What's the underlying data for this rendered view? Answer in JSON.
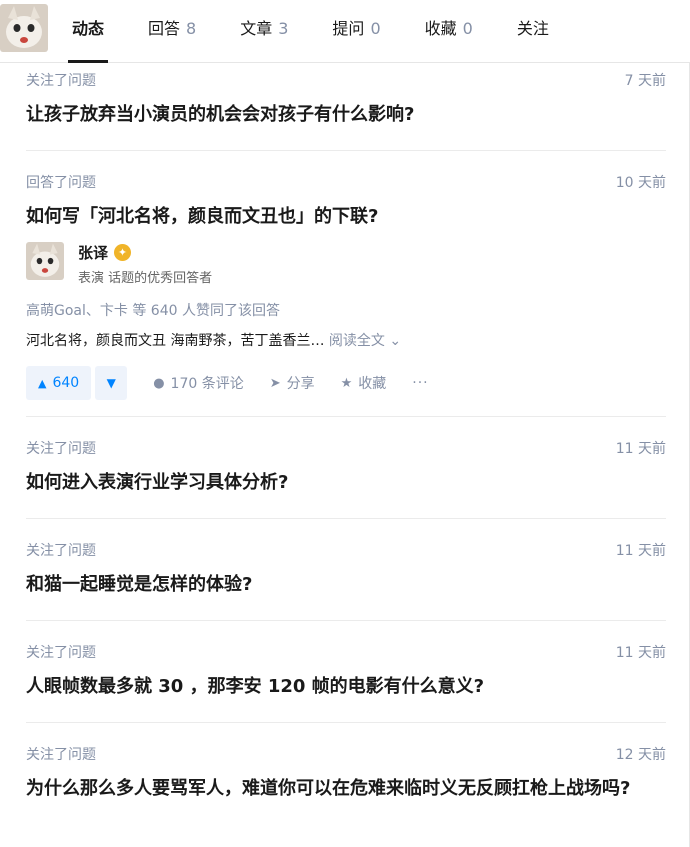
{
  "tabs": [
    {
      "label": "动态",
      "count": ""
    },
    {
      "label": "回答",
      "count": "8"
    },
    {
      "label": "文章",
      "count": "3"
    },
    {
      "label": "提问",
      "count": "0"
    },
    {
      "label": "收藏",
      "count": "0"
    },
    {
      "label": "关注",
      "count": ""
    }
  ],
  "feed": [
    {
      "action": "关注了问题",
      "time": "7 天前",
      "title": "让孩子放弃当小演员的机会会对孩子有什么影响?"
    },
    {
      "action": "回答了问题",
      "time": "10 天前",
      "title": "如何写「河北名将，颜良而文丑也」的下联?",
      "answer": {
        "author": "张译",
        "bio": "表演 话题的优秀回答者",
        "upvoters": "高萌Goal、卞卡 等 640 人赞同了该回答",
        "excerpt": "河北名将，颜良而文丑 海南野茶，苦丁盖香兰…",
        "read_all": "阅读全文",
        "votes": "640",
        "comments": "170 条评论",
        "share": "分享",
        "collect": "收藏",
        "more": "···"
      }
    },
    {
      "action": "关注了问题",
      "time": "11 天前",
      "title": "如何进入表演行业学习具体分析?"
    },
    {
      "action": "关注了问题",
      "time": "11 天前",
      "title": "和猫一起睡觉是怎样的体验?"
    },
    {
      "action": "关注了问题",
      "time": "11 天前",
      "title": "人眼帧数最多就 30 ，那李安 120 帧的电影有什么意义?"
    },
    {
      "action": "关注了问题",
      "time": "12 天前",
      "title": "为什么那么多人要骂军人，难道你可以在危难来临时义无反顾扛枪上战场吗?"
    }
  ]
}
